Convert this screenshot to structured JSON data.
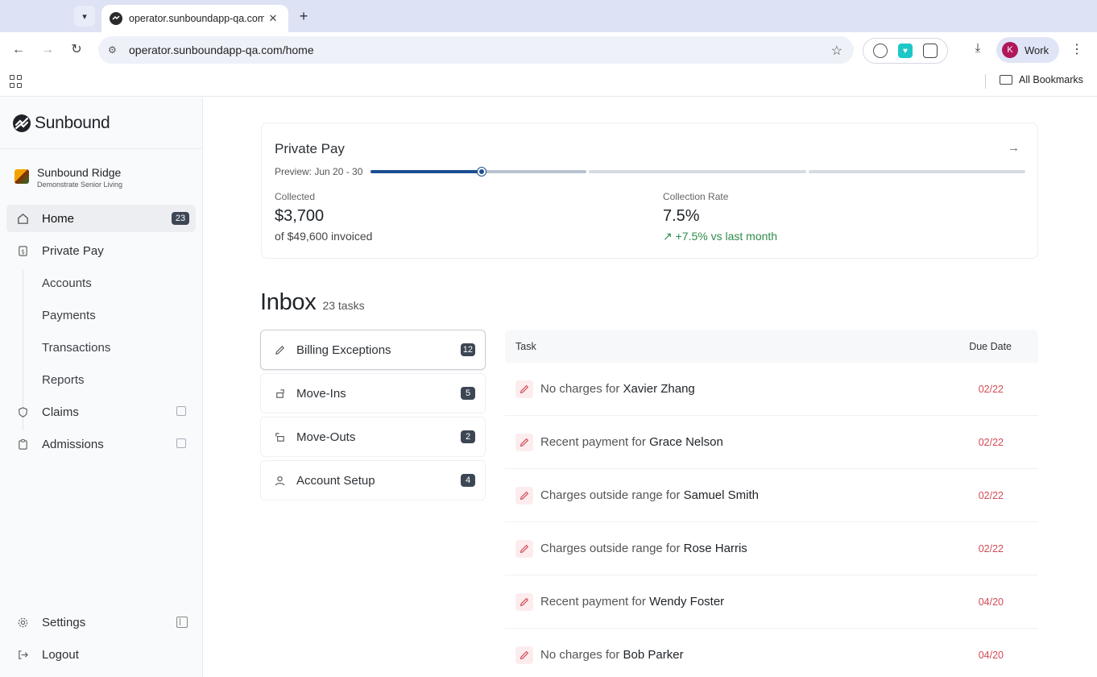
{
  "browser": {
    "tab_title": "operator.sunboundapp-qa.com",
    "tab_close": "✕",
    "new_tab": "+",
    "url": "operator.sunboundapp-qa.com/home",
    "profile_initial": "K",
    "profile_name": "Work",
    "all_bookmarks": "All Bookmarks"
  },
  "brand": {
    "name": "Sunbound"
  },
  "facility": {
    "name": "Sunbound Ridge",
    "subtitle": "Demonstrate Senior Living"
  },
  "nav": {
    "home": {
      "label": "Home",
      "badge": "23"
    },
    "private_pay": {
      "label": "Private Pay"
    },
    "sub": [
      "Accounts",
      "Payments",
      "Transactions",
      "Reports"
    ],
    "claims": {
      "label": "Claims"
    },
    "admissions": {
      "label": "Admissions"
    },
    "settings": {
      "label": "Settings"
    },
    "logout": {
      "label": "Logout"
    }
  },
  "private_pay_card": {
    "title": "Private Pay",
    "preview": "Preview: Jun 20 - 30",
    "progress_fraction": 0.17,
    "collected_label": "Collected",
    "collected_value": "$3,700",
    "collected_sub": "of $49,600 invoiced",
    "rate_label": "Collection Rate",
    "rate_value": "7.5%",
    "rate_trend": "+7.5% vs last month"
  },
  "inbox": {
    "title": "Inbox",
    "count": "23 tasks",
    "categories": [
      {
        "label": "Billing Exceptions",
        "badge": "12"
      },
      {
        "label": "Move-Ins",
        "badge": "5"
      },
      {
        "label": "Move-Outs",
        "badge": "2"
      },
      {
        "label": "Account Setup",
        "badge": "4"
      }
    ],
    "table": {
      "col_task": "Task",
      "col_due": "Due Date",
      "rows": [
        {
          "prefix": "No charges for ",
          "name": "Xavier Zhang",
          "due": "02/22"
        },
        {
          "prefix": "Recent payment for ",
          "name": "Grace Nelson",
          "due": "02/22"
        },
        {
          "prefix": "Charges outside range for ",
          "name": "Samuel Smith",
          "due": "02/22"
        },
        {
          "prefix": "Charges outside range for ",
          "name": "Rose Harris",
          "due": "02/22"
        },
        {
          "prefix": "Recent payment for ",
          "name": "Wendy Foster",
          "due": "04/20"
        },
        {
          "prefix": "No charges for ",
          "name": "Bob Parker",
          "due": "04/20"
        }
      ]
    }
  },
  "colors": {
    "accent": "#1d4f91",
    "positive": "#2e8b4a",
    "due_date": "#d04a55",
    "badge": "#3d4654"
  }
}
